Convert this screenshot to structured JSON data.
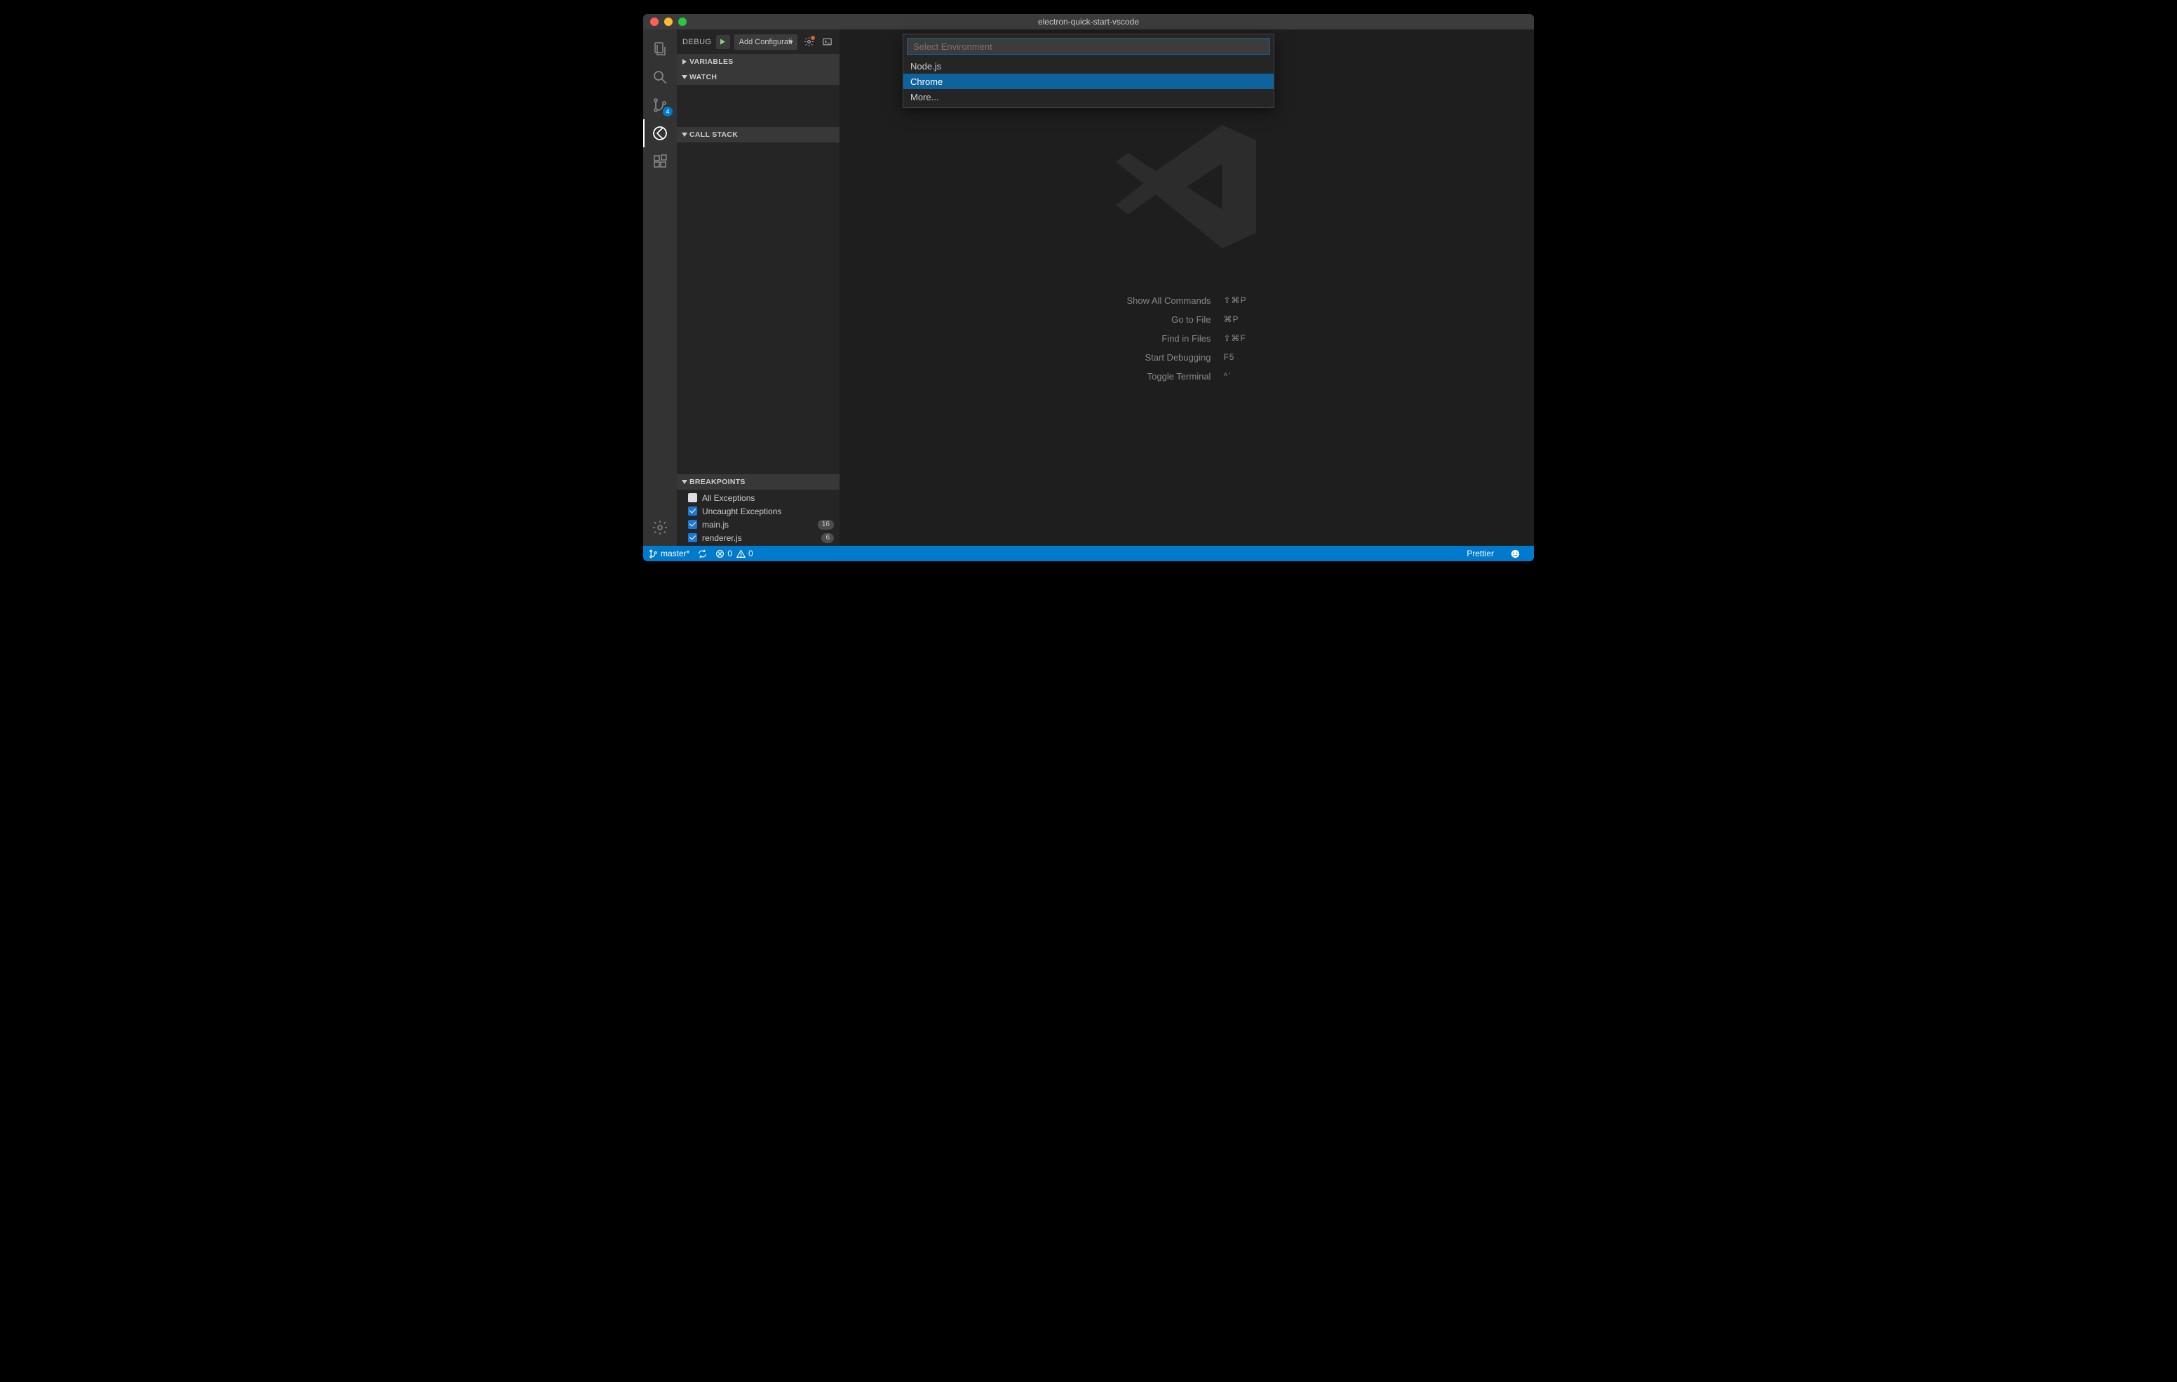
{
  "window": {
    "title": "electron-quick-start-vscode"
  },
  "activitybar": {
    "scm_badge": "4"
  },
  "sidebar": {
    "title": "DEBUG",
    "config_label": "Add Configurati",
    "sections": {
      "variables": "Variables",
      "watch": "Watch",
      "callstack": "Call Stack",
      "breakpoints": "Breakpoints"
    },
    "breakpoints": [
      {
        "label": "All Exceptions",
        "checked": false,
        "unchecked_style": true
      },
      {
        "label": "Uncaught Exceptions",
        "checked": true
      },
      {
        "label": "main.js",
        "checked": true,
        "count": "16"
      },
      {
        "label": "renderer.js",
        "checked": true,
        "count": "6"
      }
    ]
  },
  "quickpick": {
    "placeholder": "Select Environment",
    "items": [
      {
        "label": "Node.js",
        "selected": false
      },
      {
        "label": "Chrome",
        "selected": true
      },
      {
        "label": "More...",
        "selected": false
      }
    ]
  },
  "editor_hints": [
    {
      "label": "Show All Commands",
      "key": "⇧⌘P"
    },
    {
      "label": "Go to File",
      "key": "⌘P"
    },
    {
      "label": "Find in Files",
      "key": "⇧⌘F"
    },
    {
      "label": "Start Debugging",
      "key": "F5"
    },
    {
      "label": "Toggle Terminal",
      "key": "^`"
    }
  ],
  "statusbar": {
    "branch": "master*",
    "errors": "0",
    "warnings": "0",
    "prettier": "Prettier"
  }
}
